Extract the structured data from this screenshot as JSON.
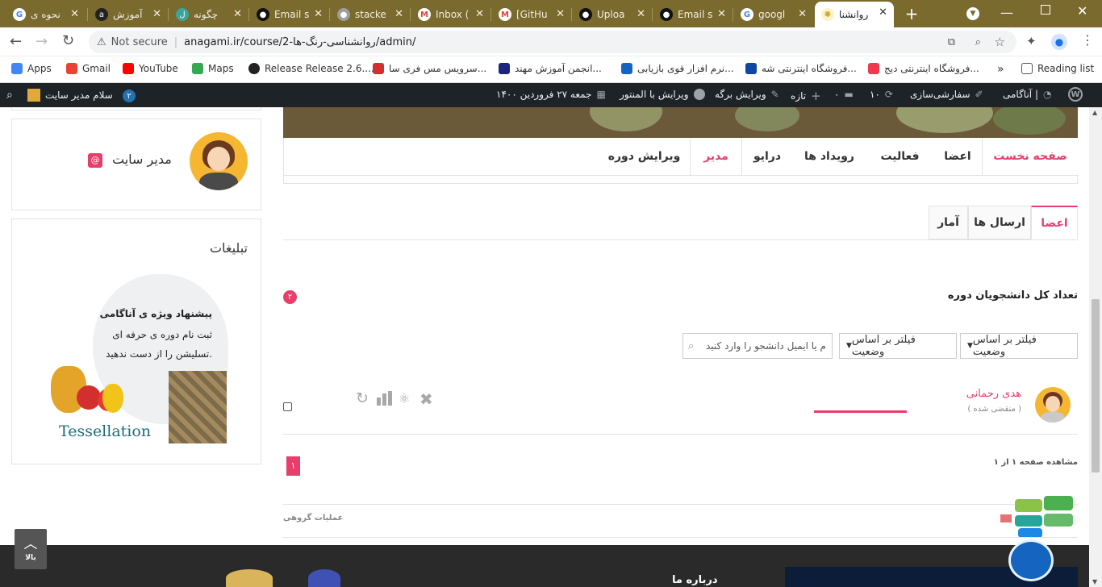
{
  "tabs": [
    {
      "title": "نحوه ی",
      "fav": "google-icon"
    },
    {
      "title": "آموزش",
      "fav": "site-icon"
    },
    {
      "title": "چگونه",
      "fav": "site-icon"
    },
    {
      "title": "Email s",
      "fav": "github-icon"
    },
    {
      "title": "stacke",
      "fav": "site-icon"
    },
    {
      "title": "Inbox (",
      "fav": "gmail-icon"
    },
    {
      "title": "[GitHu",
      "fav": "gmail-icon"
    },
    {
      "title": "Uploa",
      "fav": "github-icon"
    },
    {
      "title": "Email s",
      "fav": "github-icon"
    },
    {
      "title": "googl",
      "fav": "google-icon"
    },
    {
      "title": "روانشنا",
      "fav": "site-icon"
    }
  ],
  "toolbar": {
    "not_secure": "Not secure",
    "url": "anagami.ir/course/2-روانشناسی-رنگ-ها/admin/"
  },
  "bookmarks": [
    {
      "label": "Apps",
      "color": "#4285f4"
    },
    {
      "label": "Gmail",
      "color": "#ea4335"
    },
    {
      "label": "YouTube",
      "color": "#ff0000"
    },
    {
      "label": "Maps",
      "color": "#34a853"
    },
    {
      "label": "Release Release 2.6....",
      "color": "#222222"
    },
    {
      "label": "سرویس مس فری سا...",
      "color": "#d32f2f"
    },
    {
      "label": "انجمن آموزش مهند...",
      "color": "#1a237e"
    },
    {
      "label": "نرم افزار قوی بازیابی...",
      "color": "#1565c0"
    },
    {
      "label": "فروشگاه اینترنتی شه...",
      "color": "#0d47a1"
    },
    {
      "label": "فروشگاه اینترنتی دیج...",
      "color": "#ef394e"
    }
  ],
  "reading_list": "Reading list",
  "wpbar": {
    "site": "آناگامی |",
    "customize": "سفارشی‌سازی",
    "updates": "۱۰",
    "comments": "۰",
    "new": "تازه",
    "edit_page": "ویرایش برگه",
    "elementor": "ویرایش با المنتور",
    "date": "جمعه ۲۷ فروردین ۱۴۰۰",
    "greeting": "سلام مدیر سایت",
    "badge": "۲"
  },
  "profile": {
    "name": "مدیر سایت"
  },
  "ads": {
    "title": "تبلیغات",
    "line1": "پیشنهاد ویژه ی آناگامی",
    "line2": "ثبت نام دوره ی حرفه ای",
    "line3": "تسلیشن را از دست ندهید.",
    "brand": "Tessellation"
  },
  "course_nav": [
    "صفحه نخست",
    "اعضا",
    "فعالیت",
    "رویداد ها",
    "درایو",
    "مدیر",
    "ویرایش دوره"
  ],
  "admin_tabs": [
    "اعضا",
    "ارسال ها",
    "آمار"
  ],
  "students": {
    "label": "تعداد کل دانشجویان دوره",
    "count": "۲",
    "filter1": "فیلتر بر اساس وضعیت",
    "filter2": "فیلتر بر اساس وضعیت",
    "search_placeholder": "نام یا ایمیل دانشجو را وارد کنید"
  },
  "member": {
    "name": "هدی رحمانی",
    "status": "( منقضی شده )"
  },
  "pagination": {
    "info": "مشاهده صفحه ۱ از ۱",
    "page": "۱"
  },
  "bulk": "عملیات گروهی",
  "footer": {
    "about": "درباره ما"
  },
  "back_to_top": "بالا",
  "colors": {
    "accent": "#e83e6c",
    "wp_bar": "#1d2327",
    "tabstrip": "#7a6a2e"
  }
}
